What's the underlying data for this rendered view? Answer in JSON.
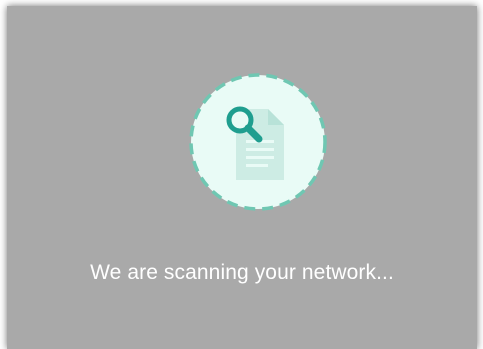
{
  "scan_dialog": {
    "icon": "document-search-icon",
    "status_text": "We are scanning your network..."
  },
  "colors": {
    "overlay": "#a9a9a9",
    "circle_fill": "#e9fbf6",
    "circle_dash": "#6fc7b2",
    "document": "#cdece4",
    "magnifier": "#1f9e8f",
    "text": "#ffffff"
  }
}
